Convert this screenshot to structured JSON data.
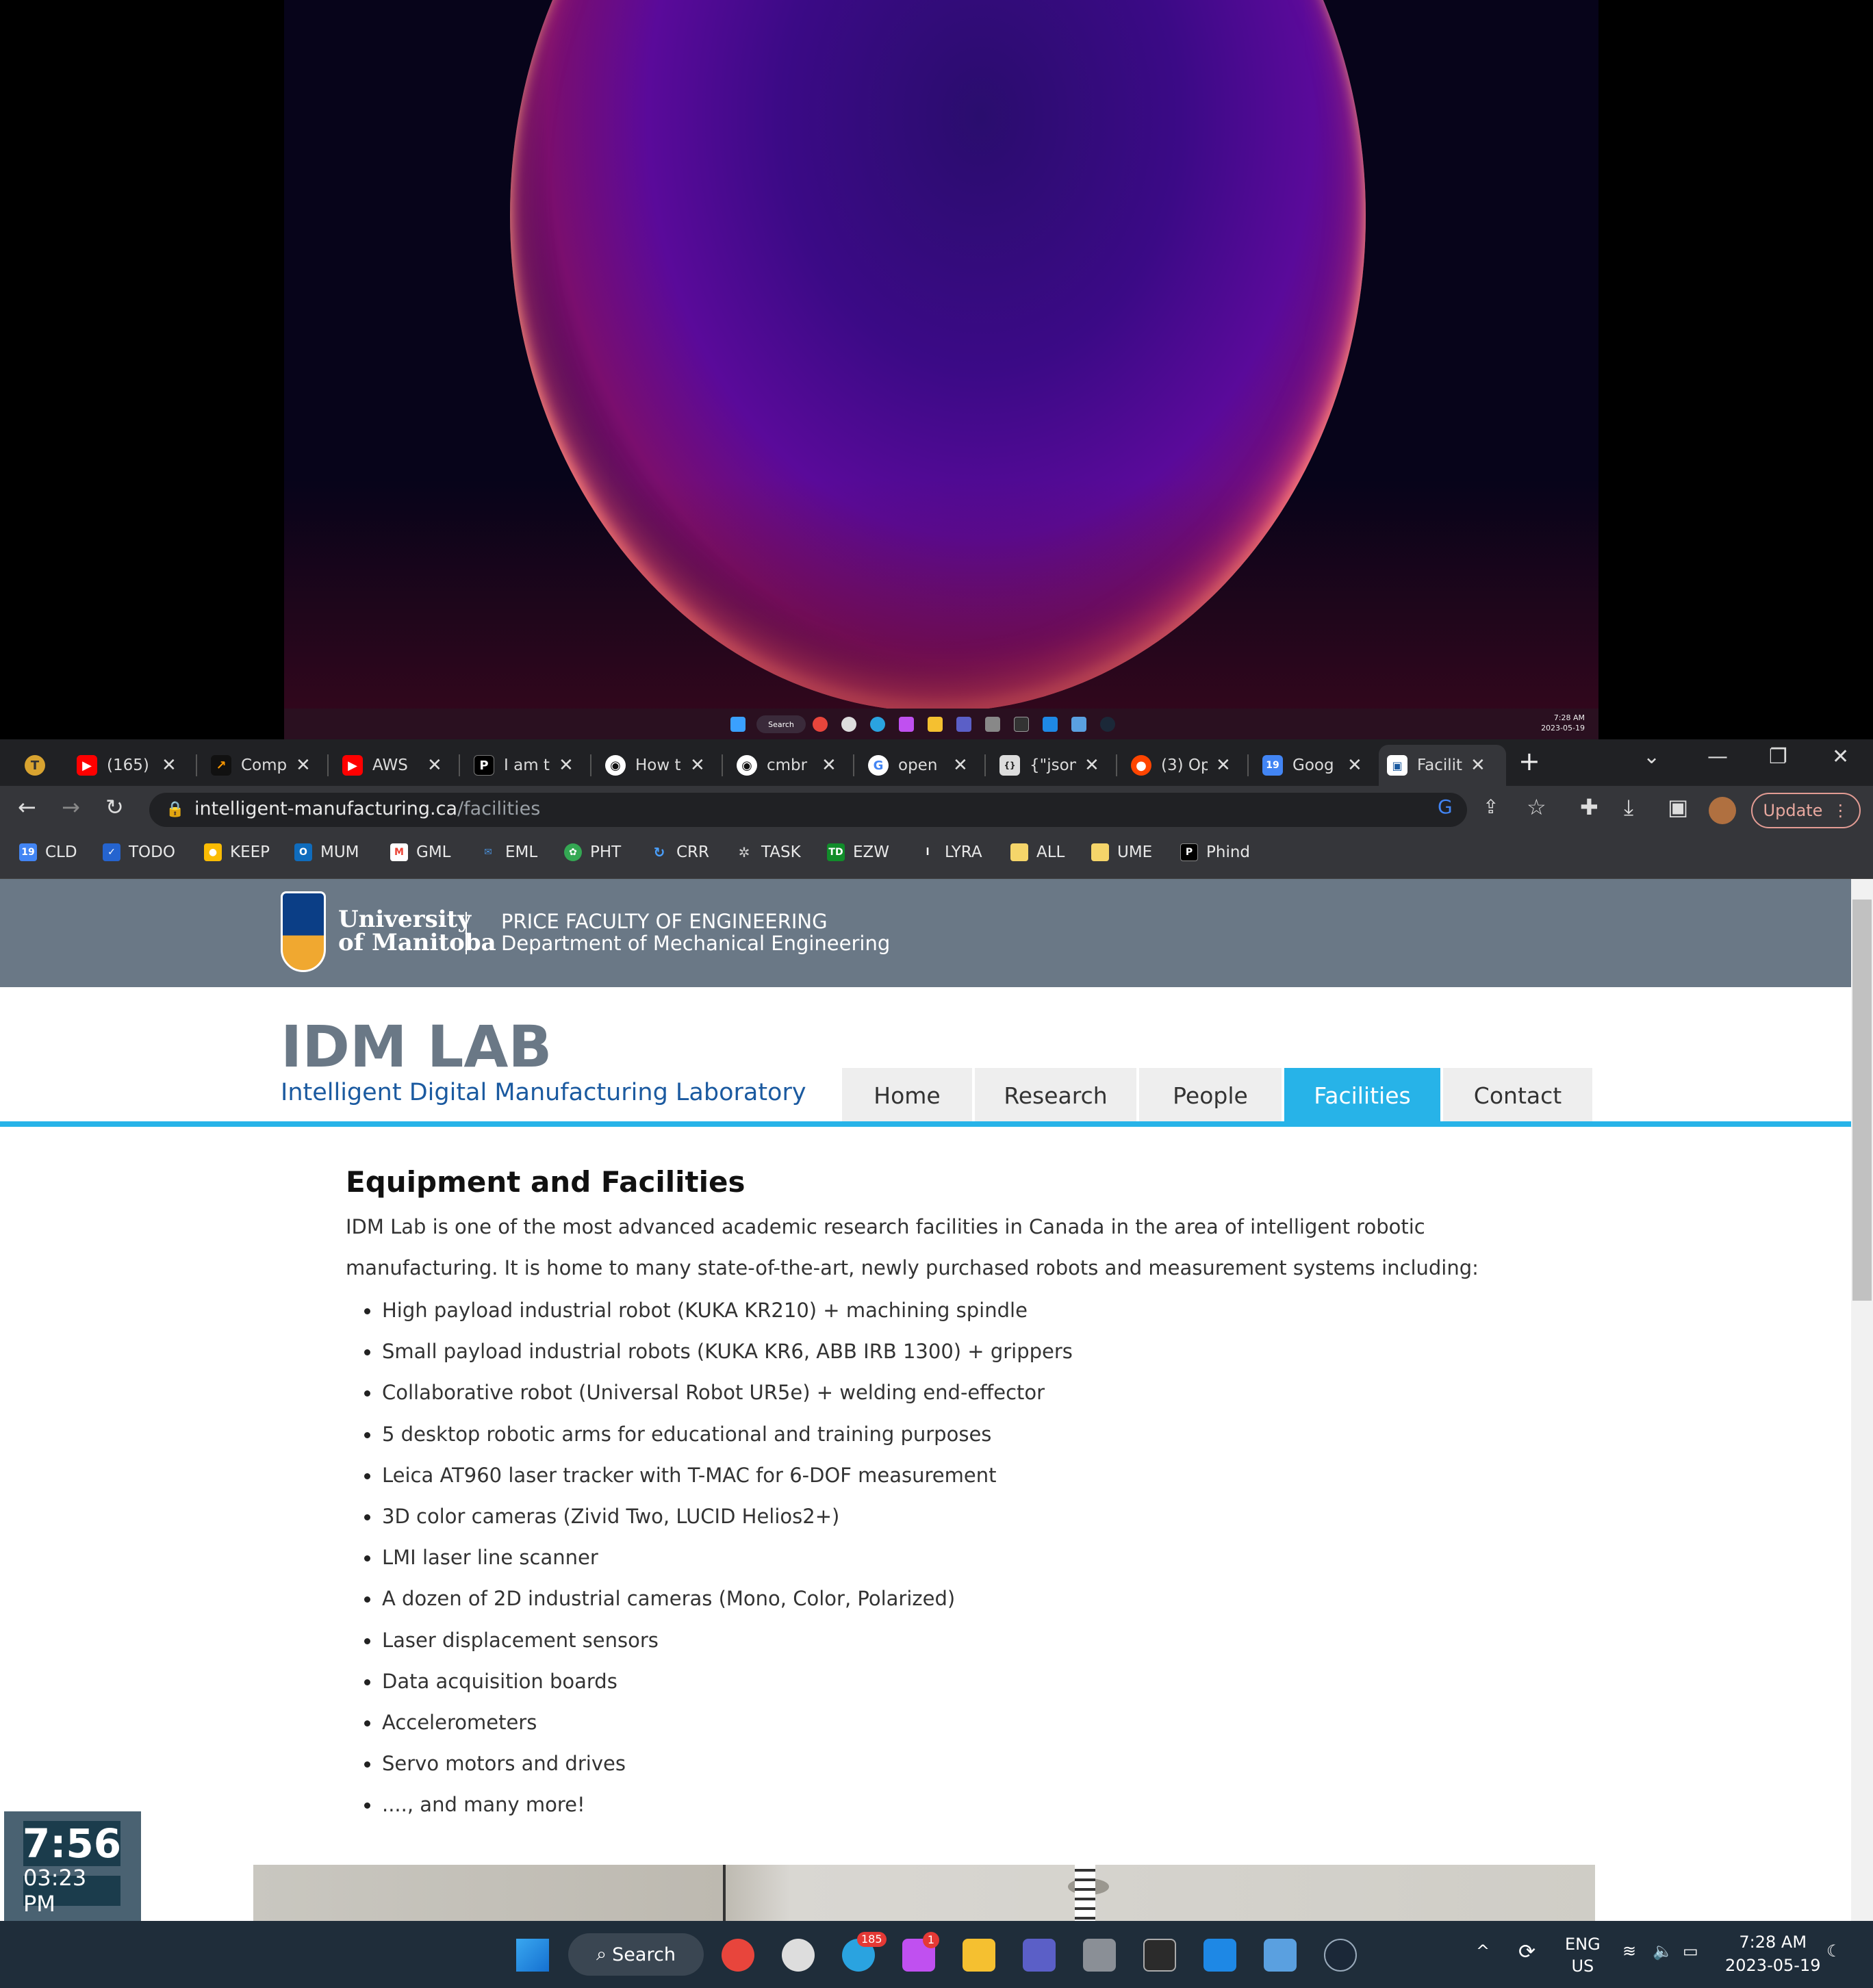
{
  "desktop": {
    "mini_clock_time": "7:28 AM",
    "mini_clock_date": "2023-05-19",
    "mini_search": "Search"
  },
  "browser": {
    "tabs": [
      {
        "icon": "avatar-t-icon",
        "title": ""
      },
      {
        "icon": "youtube-icon",
        "title": "(165)"
      },
      {
        "icon": "arrow-icon",
        "title": "Comp"
      },
      {
        "icon": "youtube-icon",
        "title": "AWS"
      },
      {
        "icon": "p-icon",
        "title": "I am t"
      },
      {
        "icon": "github-icon",
        "title": "How t"
      },
      {
        "icon": "github-icon",
        "title": "cmbr"
      },
      {
        "icon": "google-icon",
        "title": "open"
      },
      {
        "icon": "json-icon",
        "title": "{\"json"
      },
      {
        "icon": "reddit-icon",
        "title": "(3) Op"
      },
      {
        "icon": "calendar-icon",
        "title": "Goog"
      },
      {
        "icon": "page-icon",
        "title": "Facilit"
      }
    ],
    "new_tab": "+",
    "url_host": "intelligent-manufacturing.ca",
    "url_path": "/facilities",
    "update_label": "Update",
    "bookmarks": [
      "CLD",
      "TODO",
      "KEEP",
      "MUM",
      "GML",
      "EML",
      "PHT",
      "CRR",
      "TASK",
      "EZW",
      "LYRA",
      "ALL",
      "UME",
      "Phind"
    ]
  },
  "site": {
    "university_line1": "University",
    "university_line2": "of Manitoba",
    "faculty": "PRICE FACULTY OF ENGINEERING",
    "department": "Department of Mechanical Engineering",
    "lab_title": "IDM LAB",
    "lab_subtitle": "Intelligent Digital Manufacturing Laboratory",
    "nav": [
      "Home",
      "Research",
      "People",
      "Facilities",
      "Contact"
    ],
    "active_nav": "Facilities",
    "content_title": "Equipment and Facilities",
    "intro": "IDM Lab is one of the most advanced academic research facilities in Canada in the area of intelligent robotic manufacturing. It is home to many state-of-the-art, newly purchased robots and measurement systems including:",
    "equipment": [
      "High payload industrial robot (KUKA KR210) + machining spindle",
      "Small payload industrial robots (KUKA KR6, ABB IRB 1300) + grippers",
      "Collaborative robot (Universal Robot UR5e) + welding end-effector",
      "5 desktop robotic arms for educational and training purposes",
      "Leica AT960 laser tracker with T-MAC for 6-DOF measurement",
      "3D color cameras (Zivid Two, LUCID Helios2+)",
      "LMI laser line scanner",
      "A dozen of 2D industrial cameras (Mono, Color, Polarized)",
      "Laser displacement sensors",
      "Data acquisition boards",
      "Accelerometers",
      "Servo motors and drives",
      "...., and many more!"
    ]
  },
  "clock_widget": {
    "big": "7:56",
    "small": "03:23 PM"
  },
  "taskbar": {
    "search_label": "Search",
    "telegram_badge": "185",
    "app_badge": "1",
    "lang_top": "ENG",
    "lang_bottom": "US",
    "time": "7:28 AM",
    "date": "2023-05-19"
  },
  "colors": {
    "accent": "#27b3e8",
    "header": "#6a7886",
    "lab_subtitle": "#1b5aa0"
  }
}
